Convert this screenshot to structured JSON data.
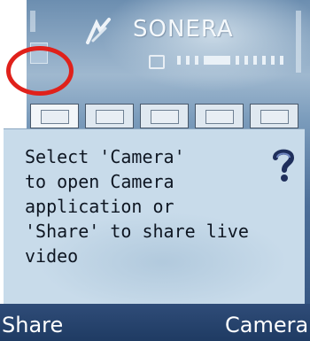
{
  "status": {
    "operator": "SONERA"
  },
  "tabs": {
    "items": [
      {
        "icon": "app-icon-1"
      },
      {
        "icon": "app-icon-2"
      },
      {
        "icon": "app-icon-3"
      },
      {
        "icon": "app-icon-4"
      },
      {
        "icon": "app-icon-5"
      }
    ]
  },
  "dialog": {
    "message": "Select 'Camera'\nto open Camera\napplication or\n'Share' to share live\nvideo",
    "icon": "question-mark-icon"
  },
  "softkeys": {
    "left": "Share",
    "right": "Camera"
  },
  "colors": {
    "annotation": "#e0211b",
    "softkey_bg": "#1f3b63",
    "dialog_bg": "#c8dbea"
  }
}
